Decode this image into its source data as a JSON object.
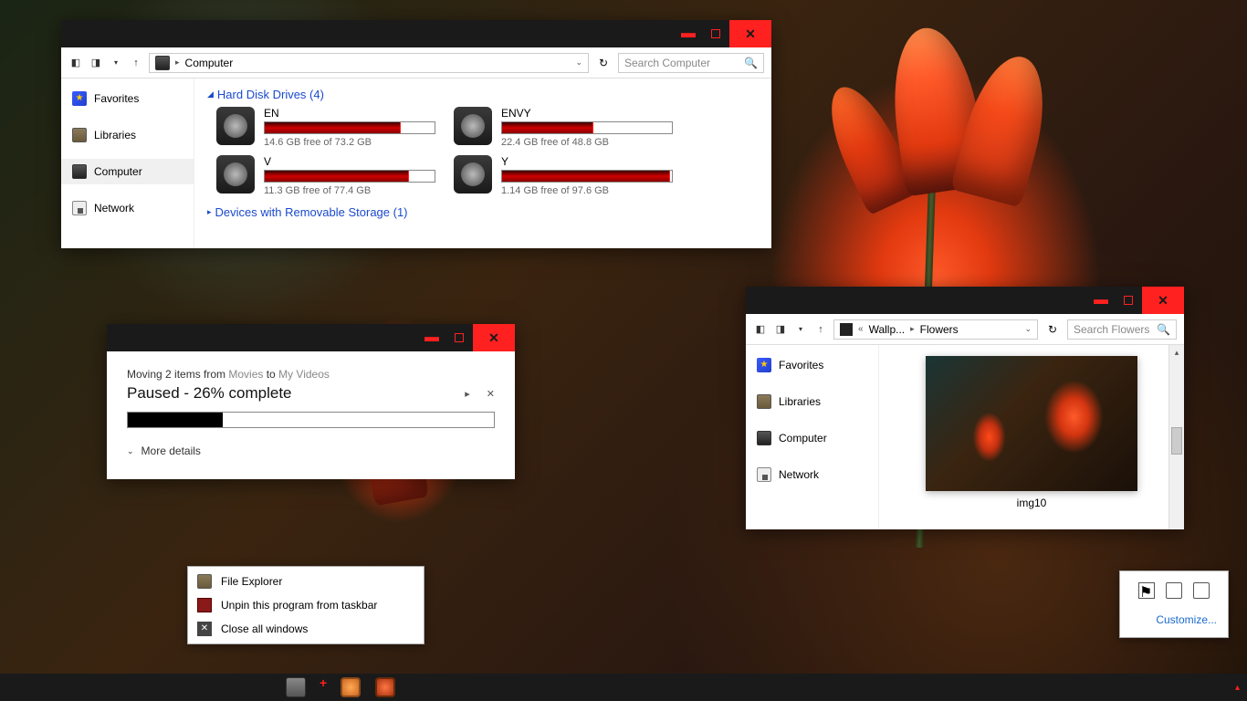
{
  "win1": {
    "address": "Computer",
    "search_placeholder": "Search Computer",
    "sidebar": {
      "favorites": "Favorites",
      "libraries": "Libraries",
      "computer": "Computer",
      "network": "Network"
    },
    "groups": {
      "hdd": "Hard Disk Drives (4)",
      "removable": "Devices with Removable Storage (1)"
    },
    "drives": [
      {
        "name": "EN",
        "free": "14.6 GB free of 73.2 GB",
        "pct": 80
      },
      {
        "name": "ENVY",
        "free": "22.4 GB free of 48.8 GB",
        "pct": 54
      },
      {
        "name": "V",
        "free": "11.3 GB free of 77.4 GB",
        "pct": 85
      },
      {
        "name": "Y",
        "free": "1.14 GB free of 97.6 GB",
        "pct": 99
      }
    ]
  },
  "win2": {
    "line_pre": "Moving 2 items from ",
    "src": "Movies",
    "mid": " to ",
    "dst": "My Videos",
    "status": "Paused - 26% complete",
    "progress": 26,
    "more": "More details"
  },
  "win3": {
    "crumb1": "Wallp...",
    "crumb2": "Flowers",
    "search_placeholder": "Search Flowers",
    "sidebar": {
      "favorites": "Favorites",
      "libraries": "Libraries",
      "computer": "Computer",
      "network": "Network"
    },
    "thumb_label": "img10"
  },
  "ctx": {
    "item1": "File Explorer",
    "item2": "Unpin this program from taskbar",
    "item3": "Close all windows"
  },
  "tray": {
    "customize": "Customize..."
  }
}
